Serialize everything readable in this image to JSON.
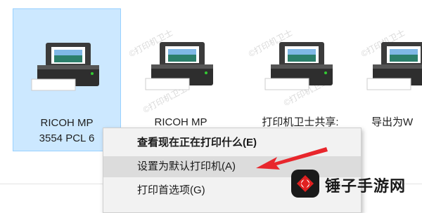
{
  "printers": [
    {
      "name": "RICOH MP\n3554 PCL 6",
      "selected": true
    },
    {
      "name": "RICOH MP",
      "selected": false
    },
    {
      "name": "打印机卫士共享:",
      "selected": false
    },
    {
      "name": "导出为W",
      "selected": false
    }
  ],
  "context_menu": {
    "items": [
      {
        "label": "查看现在正在打印什么(E)",
        "bold": true
      },
      {
        "label": "设置为默认打印机(A)",
        "highlight": true
      },
      {
        "label": "打印首选项(G)"
      }
    ]
  },
  "watermark": "©打印机卫士",
  "logo": {
    "text": "锤子手游网"
  },
  "colors": {
    "selection": "#cce8ff",
    "arrow": "#e8262c",
    "logo_accent": "#e02020"
  }
}
